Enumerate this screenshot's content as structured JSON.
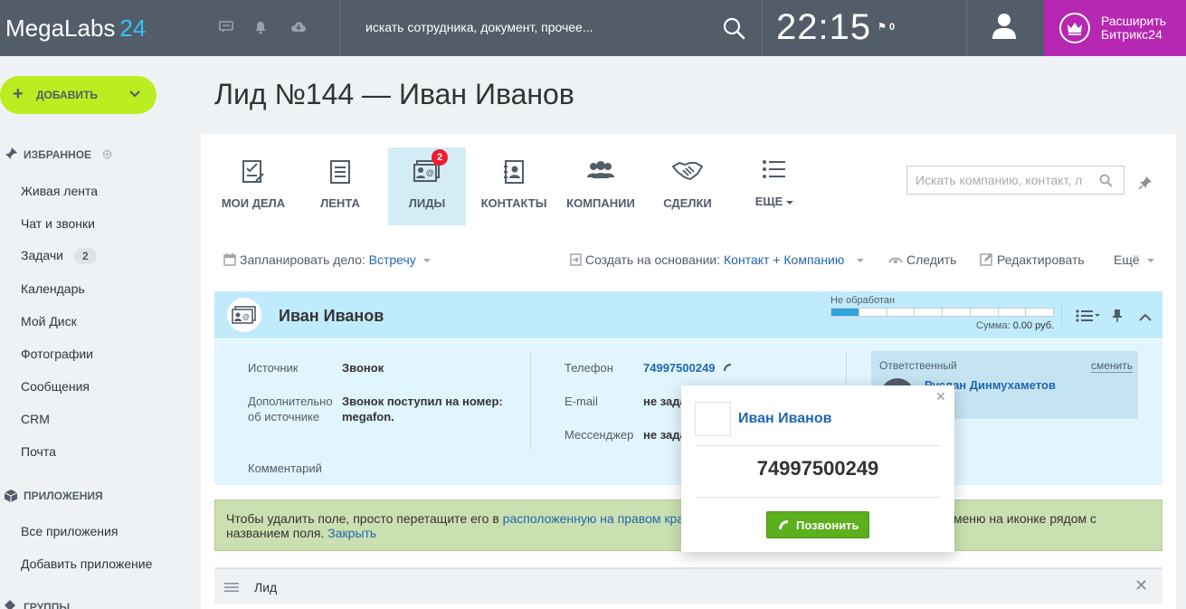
{
  "topbar": {
    "logo_main": "MegaLabs",
    "logo_num": "24",
    "search_text": "искать сотрудника, документ, прочее...",
    "clock": "22:15",
    "flag_count": "0",
    "upgrade_line1": "Расширить",
    "upgrade_line2": "Битрикс24"
  },
  "sidebar": {
    "add_button": "ДОБАВИТЬ",
    "favorites_title": "ИЗБРАННОЕ",
    "items": [
      {
        "label": "Живая лента"
      },
      {
        "label": "Чат и звонки"
      },
      {
        "label": "Задачи",
        "counter": "2"
      },
      {
        "label": "Календарь"
      },
      {
        "label": "Мой Диск"
      },
      {
        "label": "Фотографии"
      },
      {
        "label": "Сообщения"
      },
      {
        "label": "CRM"
      },
      {
        "label": "Почта"
      }
    ],
    "apps_title": "ПРИЛОЖЕНИЯ",
    "apps_items": [
      {
        "label": "Все приложения"
      },
      {
        "label": "Добавить приложение"
      }
    ],
    "groups_title": "ГРУППЫ"
  },
  "page": {
    "title": "Лид №144 — Иван Иванов"
  },
  "crm_tabs": [
    {
      "label": "МОИ ДЕЛА",
      "icon": "checklist-icon"
    },
    {
      "label": "ЛЕНТА",
      "icon": "document-icon"
    },
    {
      "label": "ЛИДЫ",
      "icon": "lead-card-icon",
      "badge": "2",
      "active": true
    },
    {
      "label": "КОНТАКТЫ",
      "icon": "contact-book-icon"
    },
    {
      "label": "КОМПАНИИ",
      "icon": "people-icon"
    },
    {
      "label": "СДЕЛКИ",
      "icon": "handshake-icon"
    },
    {
      "label": "ЕЩЕ",
      "icon": "list-icon"
    }
  ],
  "crm_search": {
    "placeholder": "Искать компанию, контакт, л"
  },
  "toolbar": {
    "plan_label": "Запланировать дело:",
    "plan_value": "Встречу",
    "create_label": "Создать на основании:",
    "create_value": "Контакт + Компанию",
    "follow": "Следить",
    "edit": "Редактировать",
    "more": "Ещё"
  },
  "lead": {
    "name": "Иван Иванов",
    "status": "Не обработан",
    "status_progress": 0.1,
    "sum_label": "Сумма:",
    "sum_value": "0.00 руб.",
    "fields": {
      "source_label": "Источник",
      "source_value": "Звонок",
      "source_extra_label_1": "Дополнительно",
      "source_extra_label_2": "об источнике",
      "source_extra_value_1": "Звонок поступил на номер:",
      "source_extra_value_2": "megafon.",
      "comment_label": "Комментарий",
      "phone_label": "Телефон",
      "phone_value": "74997500249",
      "email_label": "E-mail",
      "email_value": "не зада",
      "messenger_label": "Мессенджер",
      "messenger_value": "не зада"
    },
    "responsible": {
      "label": "Ответственный",
      "change": "сменить",
      "name": "Руслан Динмухаметов"
    }
  },
  "hint": {
    "text_before": "Чтобы удалить поле, просто перетащите его в ",
    "link1": "расположенную на правом кра",
    "text_mid": "стным меню на иконке рядом с",
    "text_after": "названием поля. ",
    "link2": "Закрыть"
  },
  "section": {
    "title": "Лид"
  },
  "popup": {
    "name": "Иван Иванов",
    "phone": "74997500249",
    "call_button": "Позвонить"
  },
  "colors": {
    "topbar": "#535c69",
    "accent_blue": "#2fc6f6",
    "upgrade": "#b627b2",
    "add_button": "#bbed21",
    "call_button": "#5caf1d",
    "link": "#2067b0",
    "badge": "#f11c30"
  }
}
